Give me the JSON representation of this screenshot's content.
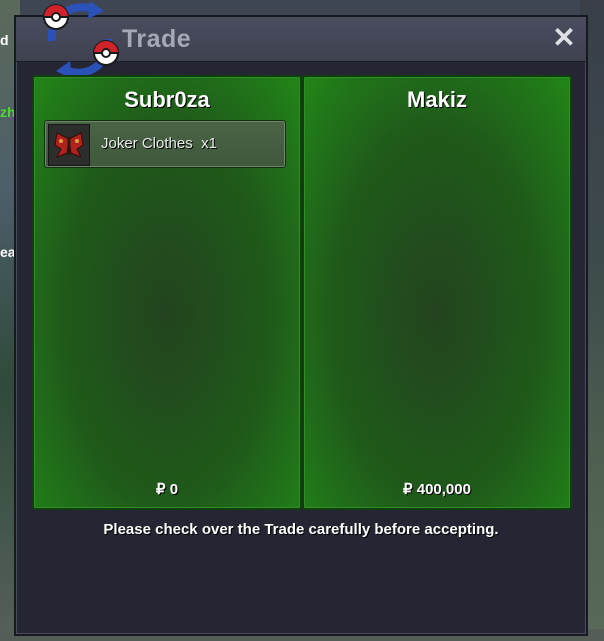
{
  "window": {
    "title": "Trade",
    "close_symbol": "✕"
  },
  "background": {
    "fragments": [
      "d",
      "zh",
      "ea"
    ]
  },
  "panels": {
    "left": {
      "player_name": "Subr0za",
      "items": [
        {
          "name": "Joker Clothes",
          "quantity": "x1",
          "icon": "butterfly-clothes-icon"
        }
      ],
      "money_symbol": "₽",
      "money": "0"
    },
    "right": {
      "player_name": "Makiz",
      "items": [],
      "money_symbol": "₽",
      "money": "400,000"
    }
  },
  "notice": "Please check over the Trade carefully before accepting.",
  "colors": {
    "panel_green": "#228618",
    "panel_dark": "#23431f",
    "window_bg": "#242633",
    "titlebar": "#4a4d5e",
    "title_text": "#a6a8b6",
    "item_bg": "#4b6446"
  }
}
